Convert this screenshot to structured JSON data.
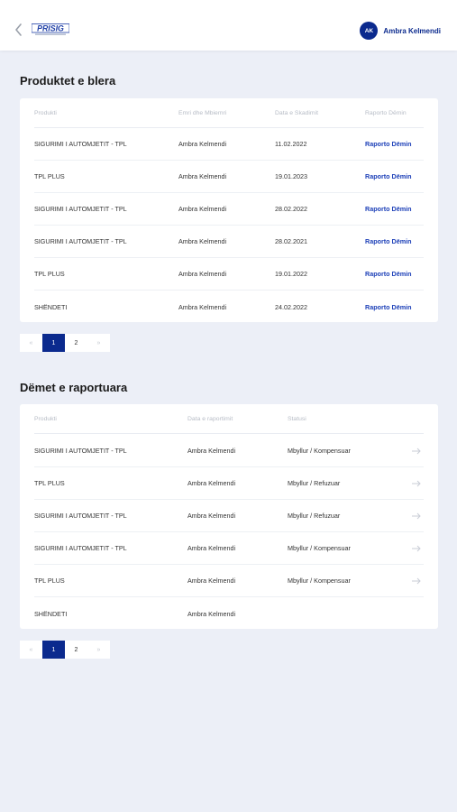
{
  "header": {
    "logo_text": "PRISIG",
    "user": {
      "initials": "AK",
      "name": "Ambra Kelmendi"
    }
  },
  "colors": {
    "brand": "#0b2a8e",
    "link": "#1d40b8",
    "background": "#eceff7"
  },
  "products": {
    "title": "Produktet e blera",
    "columns": [
      "Produkti",
      "Emri dhe Mbiemri",
      "Data e Skadimit",
      "Raporto Dëmin"
    ],
    "rows": [
      {
        "product": "SIGURIMI I AUTOMJETIT - TPL",
        "name": "Ambra Kelmendi",
        "date": "11.02.2022",
        "action": "Raporto Dëmin"
      },
      {
        "product": "TPL PLUS",
        "name": "Ambra Kelmendi",
        "date": "19.01.2023",
        "action": "Raporto Dëmin"
      },
      {
        "product": "SIGURIMI I AUTOMJETIT - TPL",
        "name": "Ambra Kelmendi",
        "date": "28.02.2022",
        "action": "Raporto Dëmin"
      },
      {
        "product": "SIGURIMI I AUTOMJETIT - TPL",
        "name": "Ambra Kelmendi",
        "date": "28.02.2021",
        "action": "Raporto Dëmin"
      },
      {
        "product": "TPL PLUS",
        "name": "Ambra Kelmendi",
        "date": "19.01.2022",
        "action": "Raporto Dëmin"
      },
      {
        "product": "SHËNDETI",
        "name": "Ambra Kelmendi",
        "date": "24.02.2022",
        "action": "Raporto Dëmin"
      }
    ],
    "pagination": {
      "prev": "«",
      "pages": [
        "1",
        "2"
      ],
      "next": "»",
      "active": "1"
    }
  },
  "claims": {
    "title": "Dëmet e raportuara",
    "columns": [
      "Produkti",
      "Data e raportimit",
      "Statusi"
    ],
    "rows": [
      {
        "product": "SIGURIMI I AUTOMJETIT - TPL",
        "name": "Ambra Kelmendi",
        "status": "Mbyllur / Kompensuar",
        "arrow": true
      },
      {
        "product": "TPL PLUS",
        "name": "Ambra Kelmendi",
        "status": "Mbyllur / Refuzuar",
        "arrow": true
      },
      {
        "product": "SIGURIMI I AUTOMJETIT - TPL",
        "name": "Ambra Kelmendi",
        "status": "Mbyllur / Refuzuar",
        "arrow": true
      },
      {
        "product": "SIGURIMI I AUTOMJETIT - TPL",
        "name": "Ambra Kelmendi",
        "status": "Mbyllur / Kompensuar",
        "arrow": true
      },
      {
        "product": "TPL PLUS",
        "name": "Ambra Kelmendi",
        "status": "Mbyllur / Kompensuar",
        "arrow": true
      },
      {
        "product": "SHËNDETI",
        "name": "Ambra Kelmendi",
        "status": "",
        "arrow": false
      }
    ],
    "pagination": {
      "prev": "«",
      "pages": [
        "1",
        "2"
      ],
      "next": "»",
      "active": "1"
    }
  }
}
